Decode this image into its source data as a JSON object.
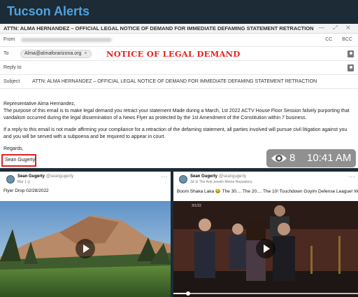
{
  "app": {
    "brand": "Tucson Alerts"
  },
  "email": {
    "window_title": "ATTN: ALMA HERNANDEZ – OFFICIAL LEGAL NOTICE OF DEMAND FOR IMMEDIATE DEFAMING STATEMENT RETRACTION",
    "window_controls": "— ⤢ ✕",
    "from_label": "From",
    "cc_label": "CC",
    "bcc_label": "BCC",
    "to_label": "To",
    "to_recipient": "Alma@almaforarizona.org",
    "to_remove": "×",
    "overlay_banner": "NOTICE OF LEGAL DEMAND",
    "reply_to_label": "Reply to",
    "subject_label": "Subject",
    "subject": "ATTN: ALMA HERNANDEZ – OFFICIAL LEGAL NOTICE OF DEMAND FOR  IMMEDIATE DEFAMING STATEMENT RETRACTION",
    "greeting": "Representative Alma Hernandez,",
    "paragraph_1": "The purpose of this email is to make legal demand you retract your statement Made during a March, 1st 2022 ACTV House Floor Session falsely purporting that vandalism occurred during the legal dissemination of a News Flyer as protected by the 1st Amendment of the Constitution within 7 business.",
    "paragraph_2": "If a reply to this email is not made affirming your compliance for a retraction of the defaming statement, all parties involved will pursue civil litigation against you and you will be served with a subpoena and be required to appear in court.",
    "closing": "Regards,",
    "signature": "Sean Gugerty"
  },
  "overlay": {
    "views": "8",
    "time": "10:41 AM"
  },
  "posts": [
    {
      "author": "Sean Gugerty",
      "handle": "@seangugerty",
      "date": "Mar 1",
      "caption": "Flyer Drop 02/28/2022",
      "more": "···"
    },
    {
      "author": "Sean Gugerty",
      "handle": "@seangugerty",
      "date": "3d",
      "group": "The Anti-Jewish Meme Repository",
      "caption": "Boom Shaka Laka 😂 The 30.... The 20.... The 10! Touchdown Goyim Defense League! White Power!",
      "video_date": "3/1/22",
      "progress": 0.08,
      "more": "···"
    }
  ],
  "colors": {
    "brand": "#4fa3e0",
    "alert_red": "#e8231e",
    "app_bg": "#1d2b36"
  }
}
